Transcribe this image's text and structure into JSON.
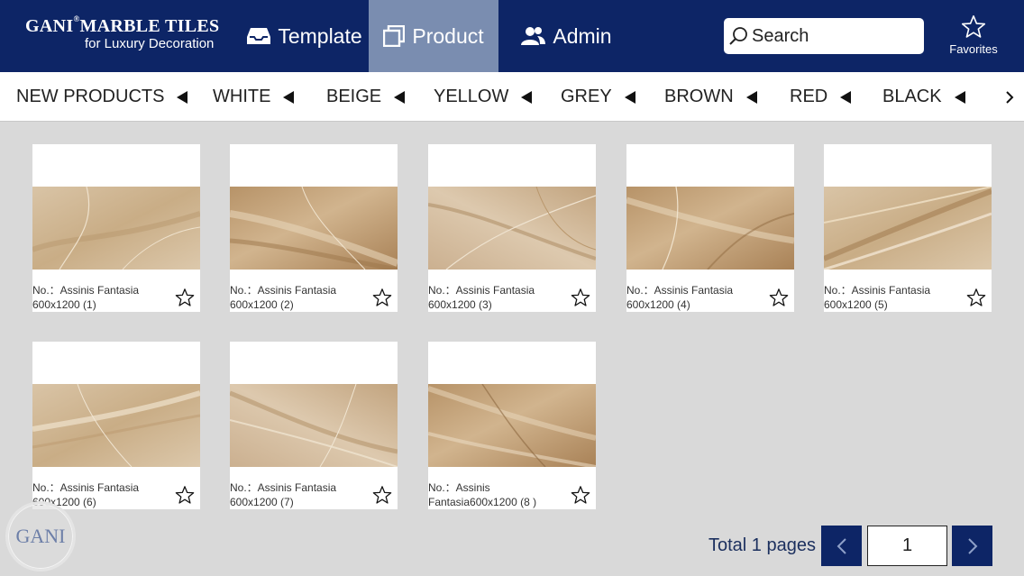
{
  "header": {
    "brand_title": "GANI",
    "brand_mark": "®",
    "brand_title_rest": "MARBLE TILES",
    "brand_subtitle": "for Luxury Decoration",
    "nav": [
      {
        "label": "Template",
        "icon": "tray-icon"
      },
      {
        "label": "Product",
        "icon": "copy-icon",
        "active": true
      },
      {
        "label": "Admin",
        "icon": "users-icon"
      }
    ],
    "search_placeholder": "Search",
    "favorites_label": "Favorites"
  },
  "categories": [
    "NEW PRODUCTS",
    "WHITE",
    "BEIGE",
    "YELLOW",
    "GREY",
    "BROWN",
    "RED",
    "BLACK"
  ],
  "products": [
    {
      "line1": "No.：Assinis Fantasia",
      "line2": "600x1200 (1)"
    },
    {
      "line1": "No.：Assinis Fantasia",
      "line2": "600x1200 (2)"
    },
    {
      "line1": "No.：Assinis Fantasia",
      "line2": "600x1200 (3)"
    },
    {
      "line1": "No.：Assinis Fantasia",
      "line2": "600x1200 (4)"
    },
    {
      "line1": "No.：Assinis Fantasia",
      "line2": "600x1200 (5)"
    },
    {
      "line1": "No.：Assinis Fantasia",
      "line2": "600x1200 (6)"
    },
    {
      "line1": "No.：Assinis Fantasia",
      "line2": "600x1200 (7)"
    },
    {
      "line1": "No.：Assinis",
      "line2": "Fantasia600x1200 (8 )"
    }
  ],
  "pagination": {
    "total_label": "Total 1 pages",
    "current_page": "1"
  },
  "floating_logo": "GANI",
  "colors": {
    "header_bg": "#0d2566",
    "nav_active_bg": "#7a8db0",
    "page_bg": "#d9d9d9",
    "marble_light": "#d6c0a0",
    "marble_dark": "#a98459"
  }
}
